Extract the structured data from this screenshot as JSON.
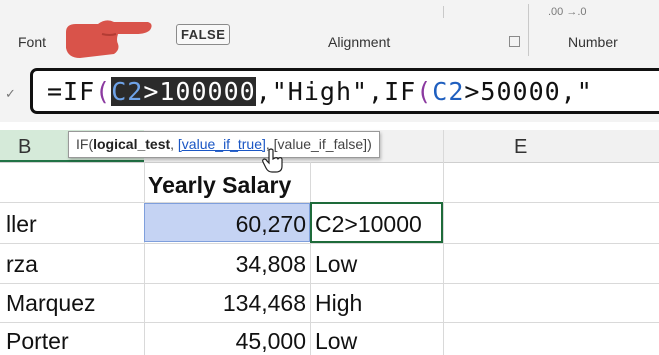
{
  "ribbon": {
    "groups": [
      {
        "label": "Font"
      },
      {
        "label": "Alignment"
      },
      {
        "label": "Number"
      }
    ],
    "number_format_hint": ".00  →.0",
    "false_badge": "FALSE",
    "dialog_launcher_icon": "dialog-launcher-icon"
  },
  "formula_bar": {
    "formula": "=IF(C2>100000,\"High\",IF(C2>50000,\"",
    "selected_segment": "C2>100000",
    "check_icon": "checkmark-icon"
  },
  "tooltip": {
    "func": "IF(",
    "arg1": "logical_test",
    "sep1": ", ",
    "arg2": "[value_if_true]",
    "sep2": ", ",
    "arg3": "[value_if_false]",
    "close": ")"
  },
  "columns": [
    "B",
    "E"
  ],
  "sheet": {
    "header": {
      "salary": "Yearly Salary"
    },
    "rows": [
      {
        "name": "ller",
        "salary": "60,270",
        "result": "C2>10000"
      },
      {
        "name": "rza",
        "salary": "34,808",
        "result": "Low"
      },
      {
        "name": "Marquez",
        "salary": "134,468",
        "result": "High"
      },
      {
        "name": "Porter",
        "salary": "45,000",
        "result": "Low"
      }
    ]
  },
  "colors": {
    "accent_green": "#217346",
    "selection_blue": "#c5d3f3",
    "ref_blue": "#1f5fbf",
    "hand_red": "#d9534a"
  }
}
